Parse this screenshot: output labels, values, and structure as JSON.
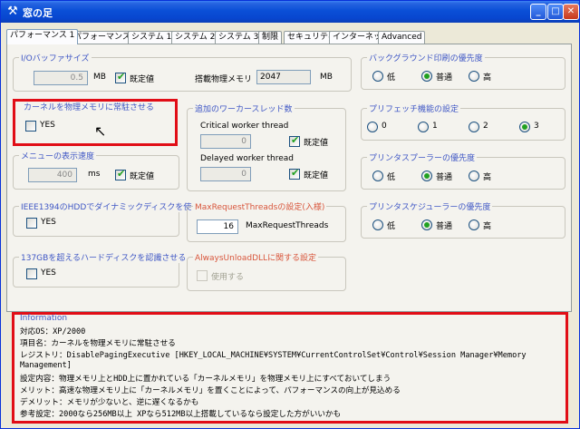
{
  "window": {
    "title": "窓の足",
    "minimize": "_",
    "maximize": "□",
    "close": "✕"
  },
  "tabs": [
    "パフォーマンス 1",
    "パフォーマンス 2",
    "システム 1",
    "システム 2",
    "システム 3",
    "制限",
    "セキュリティ",
    "インターネット",
    "Advanced"
  ],
  "active_tab": "パフォーマンス 1",
  "io_buffer": {
    "label": "I/Oバッファサイズ",
    "value": "0.5",
    "unit": "MB",
    "default_label": "既定値",
    "default_checked": true,
    "mem_label": "搭載物理メモリ",
    "mem_value": "2047",
    "mem_unit": "MB"
  },
  "kernel": {
    "label": "カーネルを物理メモリに常駐させる",
    "yes_label": "YES",
    "checked": false
  },
  "menu_speed": {
    "label": "メニューの表示速度",
    "value": "400",
    "unit": "ms",
    "default_label": "既定値",
    "default_checked": true
  },
  "ieee": {
    "label": "IEEE1394のHDDでダイナミックディスクを使う",
    "yes_label": "YES",
    "checked": false
  },
  "hdd137": {
    "label": "137GBを超えるハードディスクを認識させる",
    "yes_label": "YES",
    "checked": false
  },
  "worker": {
    "label": "追加のワーカースレッド数",
    "critical_label": "Critical worker thread",
    "critical_value": "0",
    "delayed_label": "Delayed worker thread",
    "delayed_value": "0",
    "default_label": "既定値",
    "critical_default_checked": true,
    "delayed_default_checked": true
  },
  "maxreq": {
    "label": "MaxRequestThreadsの設定(入様)",
    "value": "16",
    "name_label": "MaxRequestThreads"
  },
  "unloaddll": {
    "label": "AlwaysUnloadDLLに関する設定",
    "use_label": "使用する",
    "checked": false
  },
  "bg_print": {
    "label": "バックグラウンド印刷の優先度",
    "options": [
      "低",
      "普通",
      "高"
    ],
    "selected": 1
  },
  "prefetch": {
    "label": "プリフェッチ機能の設定",
    "options": [
      "0",
      "1",
      "2",
      "3"
    ],
    "selected": 3
  },
  "spooler": {
    "label": "プリンタスプーラーの優先度",
    "options": [
      "低",
      "普通",
      "高"
    ],
    "selected": 1
  },
  "scheduler": {
    "label": "プリンタスケジューラーの優先度",
    "options": [
      "低",
      "普通",
      "高"
    ],
    "selected": 1
  },
  "info": {
    "label": "Information",
    "lines": [
      "対応OS：XP/2000",
      "項目名：カーネルを物理メモリに常駐させる",
      "レジストリ：DisablePagingExecutive [HKEY_LOCAL_MACHINE¥SYSTEM¥CurrentControlSet¥Control¥Session Manager¥Memory",
      "Management]",
      "設定内容：物理メモリ上とHDD上に置かれている「カーネルメモリ」を物理メモリ上にすべておいてしまう",
      "メリット：高速な物理メモリ上に「カーネルメモリ」を置くことによって、パフォーマンスの向上が見込める",
      "デメリット：メモリが少ないと、逆に遅くなるかも",
      "参考設定：2000なら256MB以上 XPなら512MB以上搭載しているなら設定した方がいいかも"
    ]
  }
}
